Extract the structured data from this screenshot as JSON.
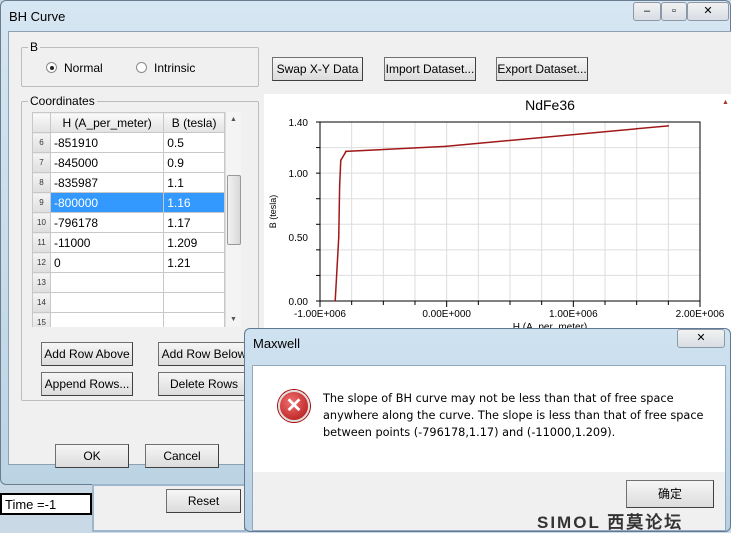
{
  "window": {
    "title": "BH Curve"
  },
  "b_group": {
    "label": "B",
    "options": [
      {
        "label": "Normal",
        "selected": true
      },
      {
        "label": "Intrinsic",
        "selected": false
      }
    ]
  },
  "toolbar": {
    "swap": "Swap X-Y Data",
    "import": "Import Dataset...",
    "export": "Export Dataset..."
  },
  "coords": {
    "label": "Coordinates",
    "columns": [
      "H (A_per_meter)",
      "B (tesla)"
    ],
    "rows": [
      {
        "n": "6",
        "h": "-851910",
        "b": "0.5"
      },
      {
        "n": "7",
        "h": "-845000",
        "b": "0.9"
      },
      {
        "n": "8",
        "h": "-835987",
        "b": "1.1"
      },
      {
        "n": "9",
        "h": "-800000",
        "b": "1.16",
        "selected": true
      },
      {
        "n": "10",
        "h": "-796178",
        "b": "1.17"
      },
      {
        "n": "11",
        "h": "-11000",
        "b": "1.209"
      },
      {
        "n": "12",
        "h": "0",
        "b": "1.21"
      },
      {
        "n": "13",
        "h": "",
        "b": ""
      },
      {
        "n": "14",
        "h": "",
        "b": ""
      },
      {
        "n": "15",
        "h": "",
        "b": ""
      }
    ]
  },
  "row_buttons": {
    "add_above": "Add Row Above",
    "add_below": "Add Row Below",
    "append": "Append Rows...",
    "delete": "Delete Rows"
  },
  "footer": {
    "ok": "OK",
    "cancel": "Cancel"
  },
  "behind": {
    "time": "Time =-1",
    "reset": "Reset"
  },
  "chart_data": {
    "type": "line",
    "title": "NdFe36",
    "xlabel": "H (A_per_meter)",
    "ylabel": "B (tesla)",
    "xlim": [
      -1000000,
      2000000
    ],
    "ylim": [
      0,
      1.4
    ],
    "xticks": [
      "-1.00E+006",
      "0.00E+000",
      "1.00E+006",
      "2.00E+006"
    ],
    "yticks": [
      "0.00",
      "0.50",
      "1.00",
      "1.40"
    ],
    "grid": true,
    "color": "#a01818",
    "x": [
      -880000,
      -851910,
      -845000,
      -835987,
      -800000,
      -796178,
      -11000,
      0,
      1750000
    ],
    "y": [
      0,
      0.5,
      0.9,
      1.1,
      1.16,
      1.17,
      1.209,
      1.21,
      1.37
    ]
  },
  "error_dialog": {
    "title": "Maxwell",
    "icon": "error-x-icon",
    "message": "The slope of BH curve may not be less than that of free space anywhere along the curve. The slope is less than that of free space between points (-796178,1.17) and (-11000,1.209).",
    "ok": "确定"
  },
  "watermark": "SIMOL西莫论坛"
}
